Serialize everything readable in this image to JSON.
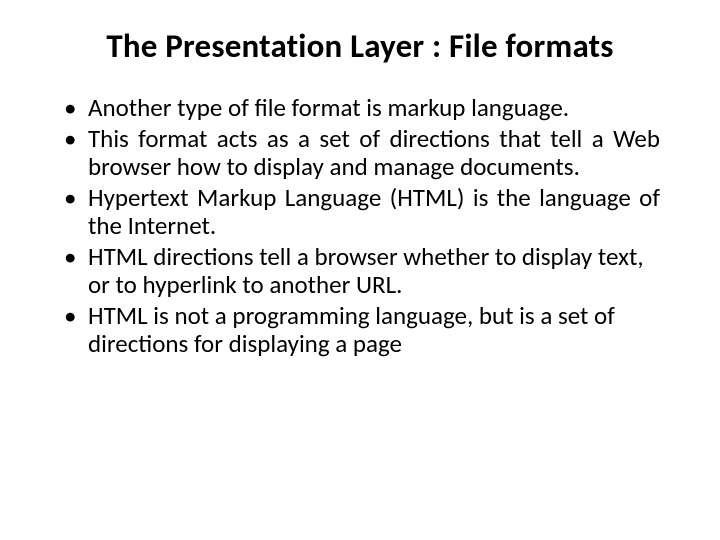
{
  "slide": {
    "title": "The Presentation Layer : File formats",
    "bullets": [
      {
        "text": "Another type of file format is markup language.",
        "justify": false
      },
      {
        "text": "This format acts as a set of directions that tell a Web browser how to display and manage documents.",
        "justify": true
      },
      {
        "text": "Hypertext Markup Language (HTML) is the language of the Internet.",
        "justify": true
      },
      {
        "text": "HTML directions tell a browser whether to display text, or to hyperlink to another URL.",
        "justify": false
      },
      {
        "text": "HTML is not a programming language, but is a set of directions for displaying a page",
        "justify": false
      }
    ]
  }
}
